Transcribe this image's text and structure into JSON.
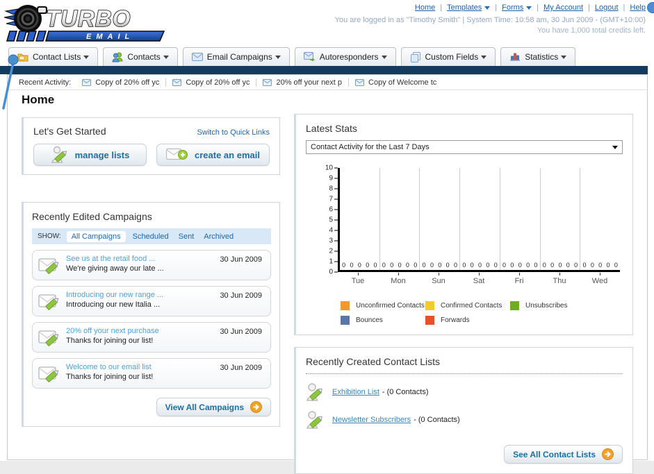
{
  "header": {
    "logo": {
      "title": "TURBO",
      "subtitle": "EMAIL"
    },
    "nav_links": [
      {
        "label": "Home",
        "dropdown": false
      },
      {
        "label": "Templates",
        "dropdown": true
      },
      {
        "label": "Forms",
        "dropdown": true
      },
      {
        "label": "My Account",
        "dropdown": false
      },
      {
        "label": "Logout",
        "dropdown": false
      },
      {
        "label": "Help",
        "dropdown": false
      }
    ],
    "login_info": "You are logged in as \"Timothy Smith\" | System Time: 10:58 am, 30 Jun 2009 - (GMT+10:00)",
    "credits_info": "You have 1,000 total credits left."
  },
  "tabs": [
    {
      "label": "Contact Lists"
    },
    {
      "label": "Contacts"
    },
    {
      "label": "Email Campaigns"
    },
    {
      "label": "Autoresponders"
    },
    {
      "label": "Custom Fields"
    },
    {
      "label": "Statistics"
    }
  ],
  "recent_activity": {
    "label": "Recent Activity:",
    "items": [
      "Copy of 20% off yc",
      "Copy of 20% off yc",
      "20% off your next p",
      "Copy of Welcome tc"
    ]
  },
  "page_title": "Home",
  "get_started": {
    "title": "Let's Get Started",
    "switch_link": "Switch to Quick Links",
    "manage_lists_label": "manage lists",
    "create_email_label": "create an email"
  },
  "campaigns": {
    "title": "Recently Edited Campaigns",
    "show_label": "SHOW:",
    "filters": [
      "All Campaigns",
      "Scheduled",
      "Sent",
      "Archived"
    ],
    "active_filter": "All Campaigns",
    "items": [
      {
        "title": "See us at the retail food ...",
        "subtitle": "We're giving away our late ...",
        "date": "30 Jun 2009"
      },
      {
        "title": "Introducing our new range ...",
        "subtitle": "Introducing our new Italia ...",
        "date": "30 Jun 2009"
      },
      {
        "title": "20% off your next purchase",
        "subtitle": "Thanks for joining our list!",
        "date": "30 Jun 2009"
      },
      {
        "title": "Welcome to our email list",
        "subtitle": "Thanks for joining our list!",
        "date": "30 Jun 2009"
      }
    ],
    "view_all_label": "View All Campaigns"
  },
  "latest_stats": {
    "title": "Latest Stats",
    "dropdown_value": "Contact Activity for the Last 7 Days"
  },
  "chart_data": {
    "type": "bar",
    "title": "Contact Activity for the Last 7 Days",
    "categories": [
      "Tue",
      "Mon",
      "Sun",
      "Sat",
      "Fri",
      "Thu",
      "Wed"
    ],
    "series": [
      {
        "name": "Unconfirmed Contacts",
        "color": "#f6972b",
        "values": [
          0,
          0,
          0,
          0,
          0,
          0,
          0
        ]
      },
      {
        "name": "Confirmed Contacts",
        "color": "#f8c92f",
        "values": [
          0,
          0,
          0,
          0,
          0,
          0,
          0
        ]
      },
      {
        "name": "Unsubscribes",
        "color": "#70ad25",
        "values": [
          0,
          0,
          0,
          0,
          0,
          0,
          0
        ]
      },
      {
        "name": "Bounces",
        "color": "#5a76a8",
        "values": [
          0,
          0,
          0,
          0,
          0,
          0,
          0
        ]
      },
      {
        "name": "Forwards",
        "color": "#e5512a",
        "values": [
          0,
          0,
          0,
          0,
          0,
          0,
          0
        ]
      }
    ],
    "ylim": [
      0,
      10
    ],
    "yticks": [
      0,
      1,
      2,
      3,
      4,
      5,
      6,
      7,
      8,
      9,
      10
    ],
    "grid": true,
    "legend_position": "bottom"
  },
  "contact_lists": {
    "title": "Recently Created Contact Lists",
    "items": [
      {
        "name": "Exhibition List",
        "count_text": "- (0 Contacts)"
      },
      {
        "name": "Newsletter Subscribers",
        "count_text": "- (0 Contacts)"
      }
    ],
    "see_all_label": "See All Contact Lists"
  }
}
